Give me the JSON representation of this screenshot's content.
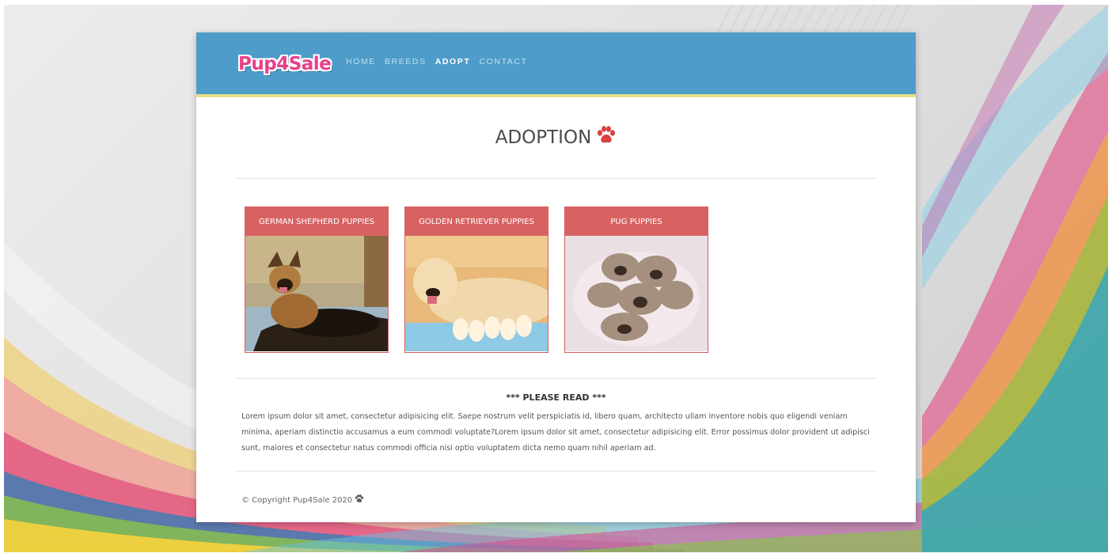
{
  "brand": {
    "logo_text": "Pup4Sale"
  },
  "nav": {
    "items": [
      {
        "label": "HOME",
        "active": false
      },
      {
        "label": "BREEDS",
        "active": false
      },
      {
        "label": "ADOPT",
        "active": true
      },
      {
        "label": "CONTACT",
        "active": false
      }
    ]
  },
  "page": {
    "title": "ADOPTION",
    "title_icon": "paw-icon"
  },
  "cards": [
    {
      "title": "GERMAN SHEPHERD PUPPIES",
      "image": "german-shepherd-with-puppies"
    },
    {
      "title": "GOLDEN RETRIEVER PUPPIES",
      "image": "golden-retriever-with-puppies"
    },
    {
      "title": "PUG PUPPIES",
      "image": "pug-puppies-pile"
    }
  ],
  "notice": {
    "title": "*** PLEASE READ ***",
    "body": "Lorem ipsum dolor sit amet, consectetur adipisicing elit. Saepe nostrum velit perspiciatis id, libero quam, architecto ullam inventore nobis quo eligendi veniam minima, aperiam distinctio accusamus a eum commodi voluptate?Lorem ipsum dolor sit amet, consectetur adipisicing elit. Error possimus dolor provident ut adipisci sunt, maiores et consectetur natus commodi officia nisi optio voluptatem dicta nemo quam nihil aperiam ad."
  },
  "footer": {
    "copyright": "© Copyright Pup4Sale 2020"
  },
  "colors": {
    "navbar": "#4e9cc9",
    "navbar_border": "#e7e08a",
    "card_header": "#d86262",
    "paw": "#d94040"
  }
}
